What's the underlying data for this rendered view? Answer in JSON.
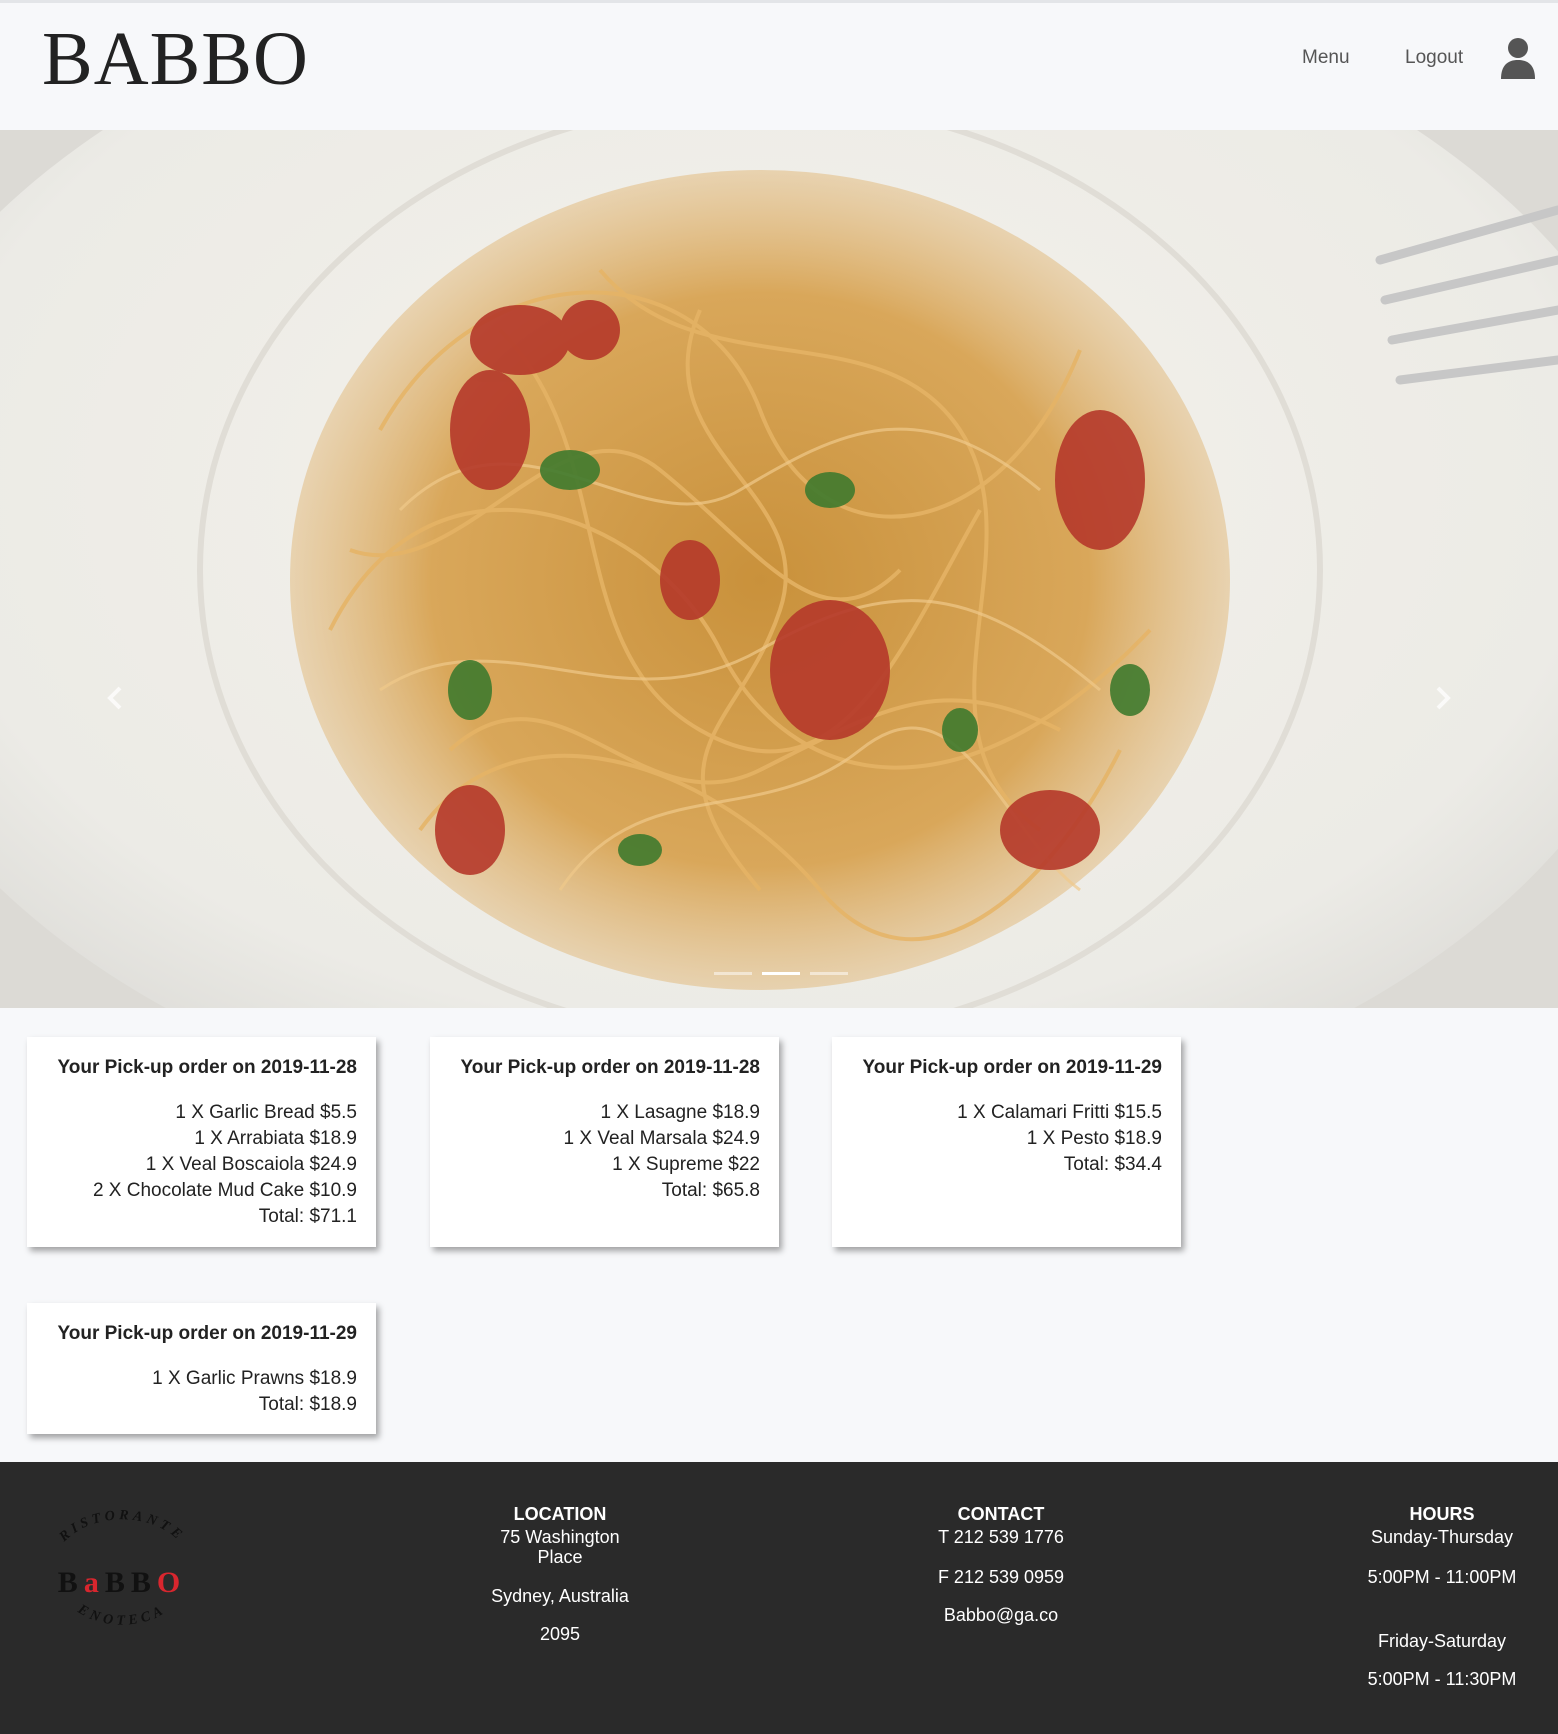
{
  "header": {
    "logo": "BABBO",
    "nav": {
      "menu_label": "Menu",
      "logout_label": "Logout"
    },
    "user_icon": "user-icon"
  },
  "hero": {
    "image": "spaghetti-dish-photo",
    "prev_icon": "chevron-left-icon",
    "next_icon": "chevron-right-icon",
    "slides": 3,
    "active_slide": 2
  },
  "orders": [
    {
      "title": "Your Pick-up order on 2019-11-28",
      "items": [
        "1 X Garlic Bread $5.5",
        "1 X Arrabiata $18.9",
        "1 X Veal Boscaiola $24.9",
        "2 X Chocolate Mud Cake $10.9"
      ],
      "total": "Total: $71.1"
    },
    {
      "title": "Your Pick-up order on 2019-11-28",
      "items": [
        "1 X Lasagne $18.9",
        "1 X Veal Marsala $24.9",
        "1 X Supreme $22"
      ],
      "total": "Total: $65.8"
    },
    {
      "title": "Your Pick-up order on 2019-11-29",
      "items": [
        "1 X Calamari Fritti $15.5",
        "1 X Pesto $18.9"
      ],
      "total": "Total: $34.4"
    },
    {
      "title": "Your Pick-up order on 2019-11-29",
      "items": [
        "1 X Garlic Prawns $18.9"
      ],
      "total": "Total: $18.9"
    }
  ],
  "footer": {
    "logo": {
      "top_text": "RISTORANTE",
      "name": "BaBBO",
      "bottom_text": "ENOTECA",
      "accent_color": "#d8262e"
    },
    "location": {
      "heading": "LOCATION",
      "line1": "75 Washington",
      "line2": "Place",
      "city": "Sydney, Australia",
      "postcode": "2095"
    },
    "contact": {
      "heading": "CONTACT",
      "phone": "T 212 539 1776",
      "fax": "F 212 539 0959",
      "email": "Babbo@ga.co"
    },
    "hours": {
      "heading": "HOURS",
      "days1": "Sunday-Thursday",
      "time1": "5:00PM - 11:00PM",
      "days2": "Friday-Saturday",
      "time2": "5:00PM - 11:30PM"
    }
  },
  "colors": {
    "page_bg": "#f7f8fa",
    "footer_bg": "#2a2a2a",
    "text": "#222222"
  }
}
